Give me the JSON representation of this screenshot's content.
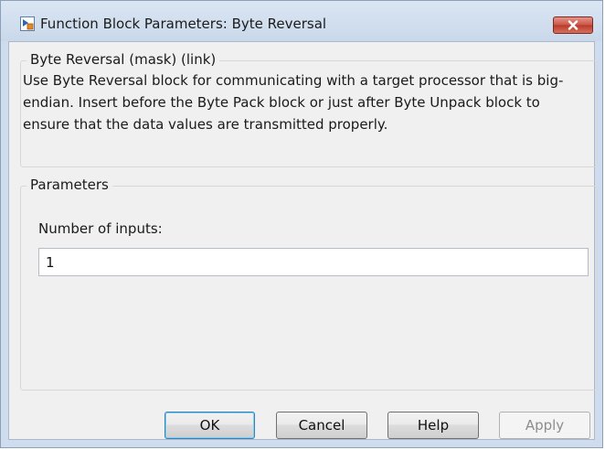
{
  "window": {
    "title": "Function Block Parameters: Byte Reversal"
  },
  "description": {
    "group_title": "Byte Reversal (mask) (link)",
    "text": "Use Byte Reversal block for communicating with a target processor that is big-endian. Insert before the Byte Pack block or just after Byte Unpack block to ensure that the data values are transmitted properly."
  },
  "parameters": {
    "group_title": "Parameters",
    "num_inputs_label": "Number of inputs:",
    "num_inputs_value": "1"
  },
  "buttons": {
    "ok": "OK",
    "cancel": "Cancel",
    "help": "Help",
    "apply": "Apply"
  },
  "icons": {
    "app": "simulink-block-icon",
    "close": "close-icon"
  },
  "colors": {
    "close_button": "#c75446",
    "window_frame": "#cfdced"
  }
}
